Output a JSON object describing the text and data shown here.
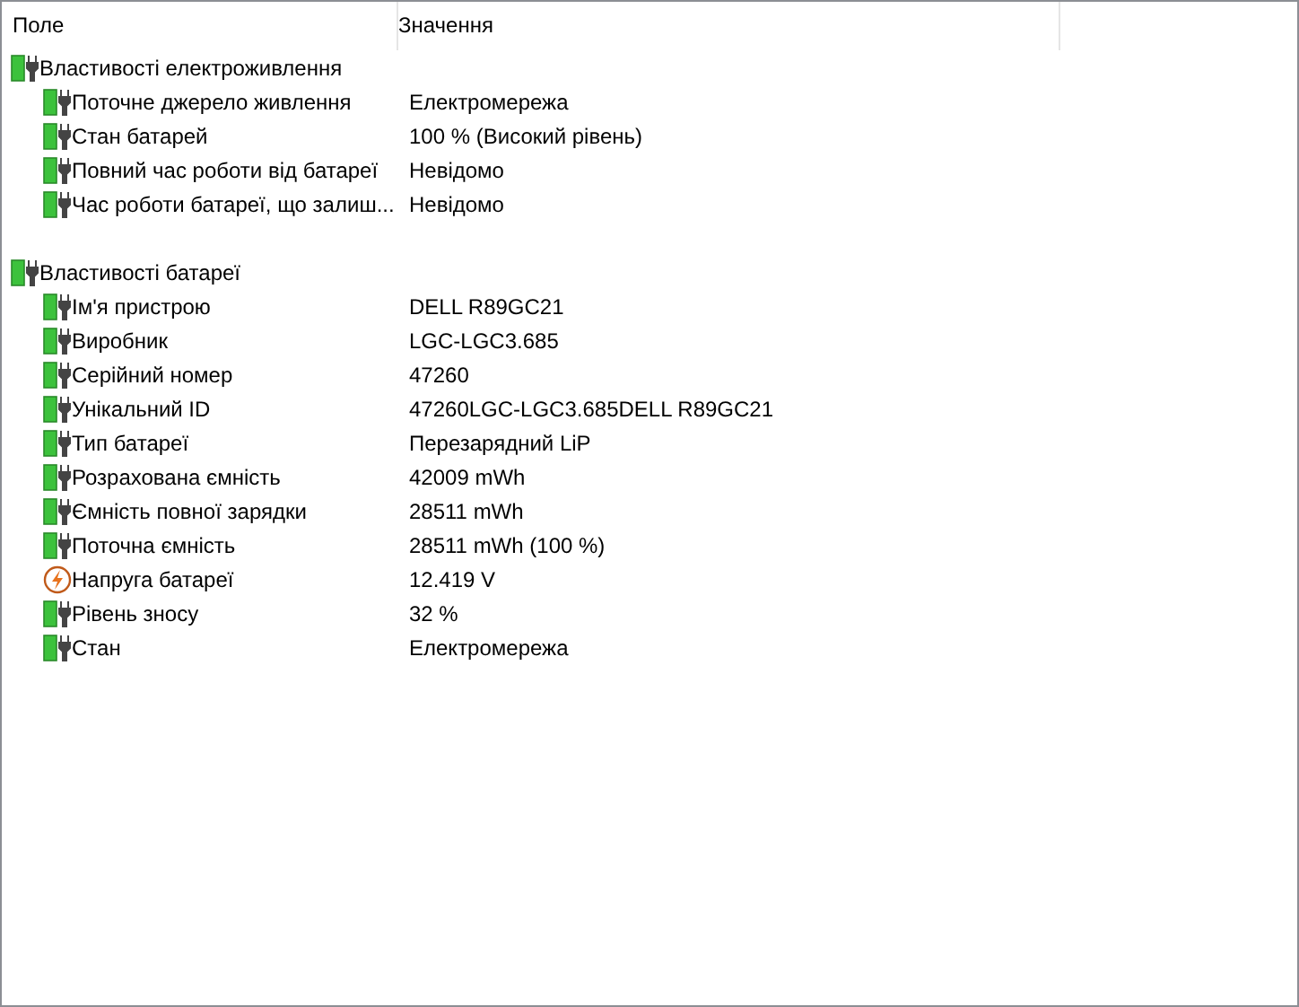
{
  "columns": [
    "Поле",
    "Значення"
  ],
  "groups": [
    {
      "label": "Властивості електроживлення",
      "kind": "battery",
      "children": [
        {
          "field": "Поточне джерело живлення",
          "value": "Електромережа",
          "kind": "battery"
        },
        {
          "field": "Стан батарей",
          "value": "100 % (Високий рівень)",
          "kind": "battery"
        },
        {
          "field": "Повний час роботи від батареї",
          "value": "Невідомо",
          "kind": "battery"
        },
        {
          "field": "Час роботи батареї, що залиш...",
          "value": "Невідомо",
          "kind": "battery"
        }
      ]
    },
    {
      "label": "Властивості батареї",
      "kind": "battery",
      "children": [
        {
          "field": "Ім'я пристрою",
          "value": "DELL R89GC21",
          "kind": "battery"
        },
        {
          "field": "Виробник",
          "value": "LGC-LGC3.685",
          "kind": "battery"
        },
        {
          "field": "Серійний номер",
          "value": "47260",
          "kind": "battery"
        },
        {
          "field": "Унікальний ID",
          "value": "47260LGC-LGC3.685DELL R89GC21",
          "kind": "battery"
        },
        {
          "field": "Тип батареї",
          "value": "Перезарядний LiP",
          "kind": "battery"
        },
        {
          "field": "Розрахована ємність",
          "value": "42009 mWh",
          "kind": "battery"
        },
        {
          "field": "Ємність повної зарядки",
          "value": "28511 mWh",
          "kind": "battery"
        },
        {
          "field": "Поточна ємність",
          "value": "28511 mWh  (100 %)",
          "kind": "battery"
        },
        {
          "field": "Напруга батареї",
          "value": "12.419 V",
          "kind": "voltage"
        },
        {
          "field": "Рівень зносу",
          "value": "32 %",
          "kind": "battery"
        },
        {
          "field": "Стан",
          "value": "Електромережа",
          "kind": "battery"
        }
      ]
    }
  ]
}
